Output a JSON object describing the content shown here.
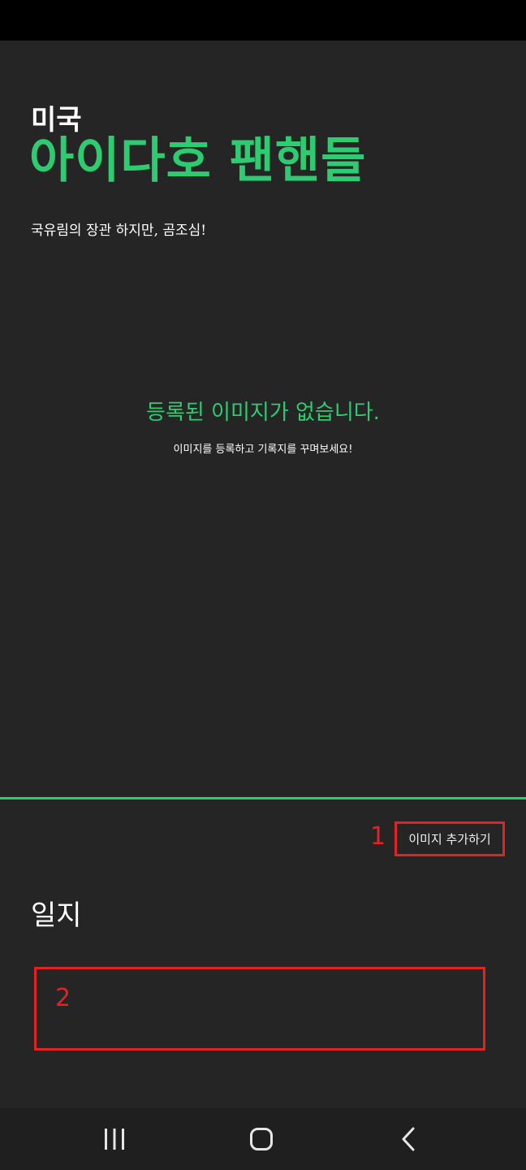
{
  "header": {
    "country": "미국",
    "place_name": "아이다호 팬핸들",
    "subtitle": "국유림의 장관 하지만, 곰조심!"
  },
  "gallery": {
    "empty_title": "등록된 이미지가 없습니다.",
    "empty_description": "이미지를 등록하고 기록지를 꾸며보세요!"
  },
  "actions": {
    "add_image_label": "이미지 추가하기"
  },
  "journal": {
    "heading": "일지",
    "value": ""
  },
  "annotations": {
    "marker_1": "1",
    "marker_2": "2",
    "highlight_color": "#e02424"
  },
  "colors": {
    "accent": "#2ecc71",
    "background": "#252525",
    "status_bar": "#000000",
    "nav_bar": "#1f1f1f"
  },
  "navigation": {
    "recent_apps_icon": "recent-apps-icon",
    "home_icon": "home-icon",
    "back_icon": "back-chevron-icon"
  }
}
